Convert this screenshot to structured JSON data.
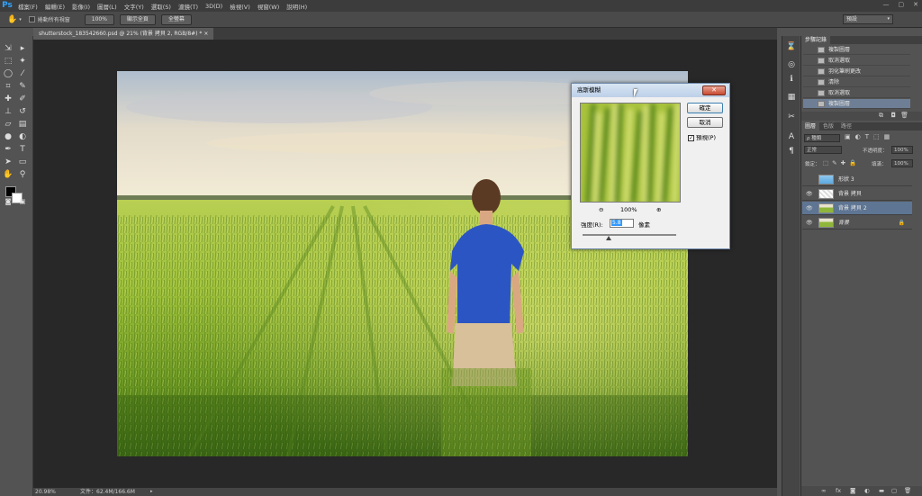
{
  "app": {
    "logo": "Ps"
  },
  "menu": [
    "檔案(F)",
    "編輯(E)",
    "影像(I)",
    "圖層(L)",
    "文字(Y)",
    "選取(S)",
    "濾鏡(T)",
    "3D(D)",
    "檢視(V)",
    "視窗(W)",
    "說明(H)"
  ],
  "window_controls": [
    "—",
    "▢",
    "✕"
  ],
  "options": {
    "scroll_all_label": "捲動所有視窗",
    "zoom_100": "100%",
    "fit_screen": "顯示全頁",
    "fill_screen": "全螢幕",
    "workspace": "預設"
  },
  "document": {
    "tab_title": "shutterstock_183542660.psd @ 21% (背景 拷貝 2, RGB/8#) *  ×"
  },
  "status": {
    "zoom": "20.98%",
    "doc_size": "文件：62.4M/166.6M"
  },
  "history": {
    "tab": "步驟記錄",
    "items": [
      "複製圖層",
      "取消選取",
      "羽化筆刷更改",
      "清除",
      "取消選取",
      "複製圖層"
    ],
    "selected_index": 5
  },
  "layers": {
    "tabs": [
      "圖層",
      "色版",
      "路徑"
    ],
    "kind": "ρ 種類",
    "blend_mode": "正常",
    "opacity_label": "不透明度：",
    "opacity_value": "100%",
    "lock_label": "鎖定：",
    "fill_label": "填滿：",
    "fill_value": "100%",
    "items": [
      {
        "name": "形狀 3",
        "visible": false
      },
      {
        "name": "背景 拷貝",
        "visible": true
      },
      {
        "name": "背景 拷貝 2",
        "visible": true
      },
      {
        "name": "背景",
        "visible": true
      }
    ],
    "selected_index": 2
  },
  "dialog": {
    "title": "高斯模糊",
    "close": "✕",
    "ok": "確定",
    "cancel": "取消",
    "preview_label": "預視(P)",
    "preview_checked": "✓",
    "zoom_value": "100%",
    "radius_label": "強度(R):",
    "radius_value": "5.8",
    "radius_unit": "像素"
  },
  "colors": {
    "ps_blue": "#2fa3ff",
    "selection_highlight": "#5e7593",
    "dialog_close_red": "#c84a33"
  }
}
